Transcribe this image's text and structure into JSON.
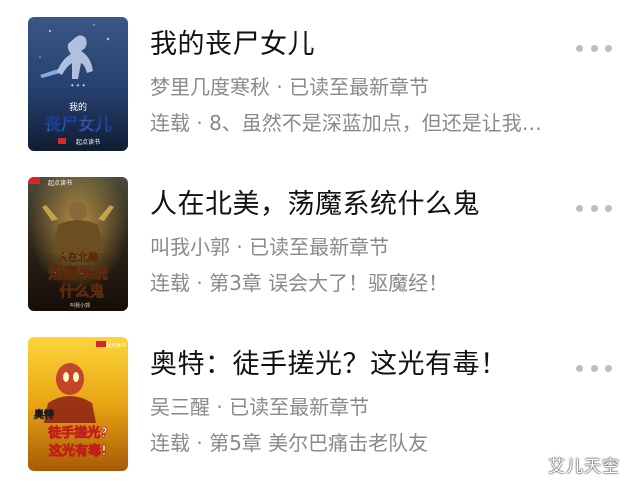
{
  "books": [
    {
      "title": "我的丧尸女儿",
      "author": "梦里几度寒秋",
      "progress_status": "已读至最新章节",
      "separator": "·",
      "update_status": "连载",
      "latest_chapter": "8、虽然不是深蓝加点，但还是让我…",
      "cover": {
        "title_line1": "我的",
        "title_line2": "丧尸女儿",
        "publisher": "起点读书",
        "colors": {
          "top": "#2a3f6e",
          "bottom": "#0f1c33",
          "accent": "#6fa8ff",
          "title": "#ffffff"
        }
      }
    },
    {
      "title": "人在北美，荡魔系统什么鬼",
      "author": "叫我小郭",
      "progress_status": "已读至最新章节",
      "separator": "·",
      "update_status": "连载",
      "latest_chapter": "第3章 误会大了！驱魔经！",
      "cover": {
        "title_line1": "人在北美",
        "title_line2": "荡魔系统",
        "title_line3": "什么鬼",
        "publisher": "起点读书",
        "author_on_cover": "叫我小郭",
        "colors": {
          "top": "#3a3a2e",
          "bottom": "#1a120c",
          "accent": "#c8a24a",
          "title": "#f4d46a"
        }
      }
    },
    {
      "title": "奥特：徒手搓光？这光有毒！",
      "author": "吴三醒",
      "progress_status": "已读至最新章节",
      "separator": "·",
      "update_status": "连载",
      "latest_chapter": "第5章 美尔巴痛击老队友",
      "cover": {
        "title_line1": "奥特",
        "title_line2": "徒手搓光?",
        "title_line3": "这光有毒!",
        "publisher": "起点读书",
        "colors": {
          "top": "#f6c21a",
          "bottom": "#b86a0a",
          "accent": "#e03020",
          "title": "#ffffff"
        }
      }
    }
  ],
  "more_icon": "more-horizontal-icon",
  "watermark": "艾儿天空"
}
